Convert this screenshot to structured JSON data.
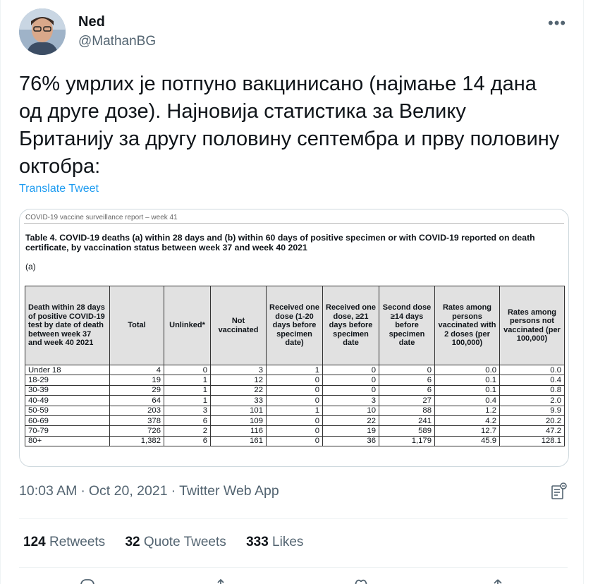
{
  "author": {
    "name": "Ned",
    "handle": "@MathanBG"
  },
  "more_label": "•••",
  "tweet_text": "76% умрлих је потпуно вакцинисано (најмање 14 дана од друге дозе). Најновија статистика за Велику Британију за другу половину септембра и прву половину октобра:",
  "translate_label": "Translate Tweet",
  "media": {
    "header": "COVID-19 vaccine surveillance report – week 41",
    "title": "Table 4. COVID-19 deaths (a) within 28 days and (b) within 60 days of positive specimen or with COVID-19 reported on death certificate, by vaccination status between week 37 and week 40 2021",
    "sub": "(a)",
    "columns": [
      "Death within 28 days of positive COVID-19 test by date of death between week 37 and week 40 2021",
      "Total",
      "Unlinked*",
      "Not vaccinated",
      "Received one dose (1-20 days before specimen date)",
      "Received one dose, ≥21 days before specimen date",
      "Second dose ≥14 days before specimen date",
      "Rates among persons vaccinated with 2 doses (per 100,000)",
      "Rates among persons not vaccinated (per 100,000)"
    ],
    "rows": [
      [
        "Under 18",
        "4",
        "0",
        "3",
        "1",
        "0",
        "0",
        "0.0",
        "0.0"
      ],
      [
        "18-29",
        "19",
        "1",
        "12",
        "0",
        "0",
        "6",
        "0.1",
        "0.4"
      ],
      [
        "30-39",
        "29",
        "1",
        "22",
        "0",
        "0",
        "6",
        "0.1",
        "0.8"
      ],
      [
        "40-49",
        "64",
        "1",
        "33",
        "0",
        "3",
        "27",
        "0.4",
        "2.0"
      ],
      [
        "50-59",
        "203",
        "3",
        "101",
        "1",
        "10",
        "88",
        "1.2",
        "9.9"
      ],
      [
        "60-69",
        "378",
        "6",
        "109",
        "0",
        "22",
        "241",
        "4.2",
        "20.2"
      ],
      [
        "70-79",
        "726",
        "2",
        "116",
        "0",
        "19",
        "589",
        "12.7",
        "47.2"
      ],
      [
        "80+",
        "1,382",
        "6",
        "161",
        "0",
        "36",
        "1,179",
        "45.9",
        "128.1"
      ]
    ]
  },
  "meta": {
    "time": "10:03 AM",
    "date": "Oct 20, 2021",
    "source": "Twitter Web App",
    "separator": "·"
  },
  "stats": {
    "retweets_count": "124",
    "retweets_label": "Retweets",
    "quotes_count": "32",
    "quotes_label": "Quote Tweets",
    "likes_count": "333",
    "likes_label": "Likes"
  },
  "icons": {
    "more": "more-dots-icon",
    "analytics": "analytics-icon",
    "reply": "reply-icon",
    "retweet": "retweet-icon",
    "like": "heart-icon",
    "share": "share-icon"
  },
  "colors": {
    "link": "#1d9bf0",
    "secondary_text": "#536471",
    "divider": "#eff3f4"
  }
}
